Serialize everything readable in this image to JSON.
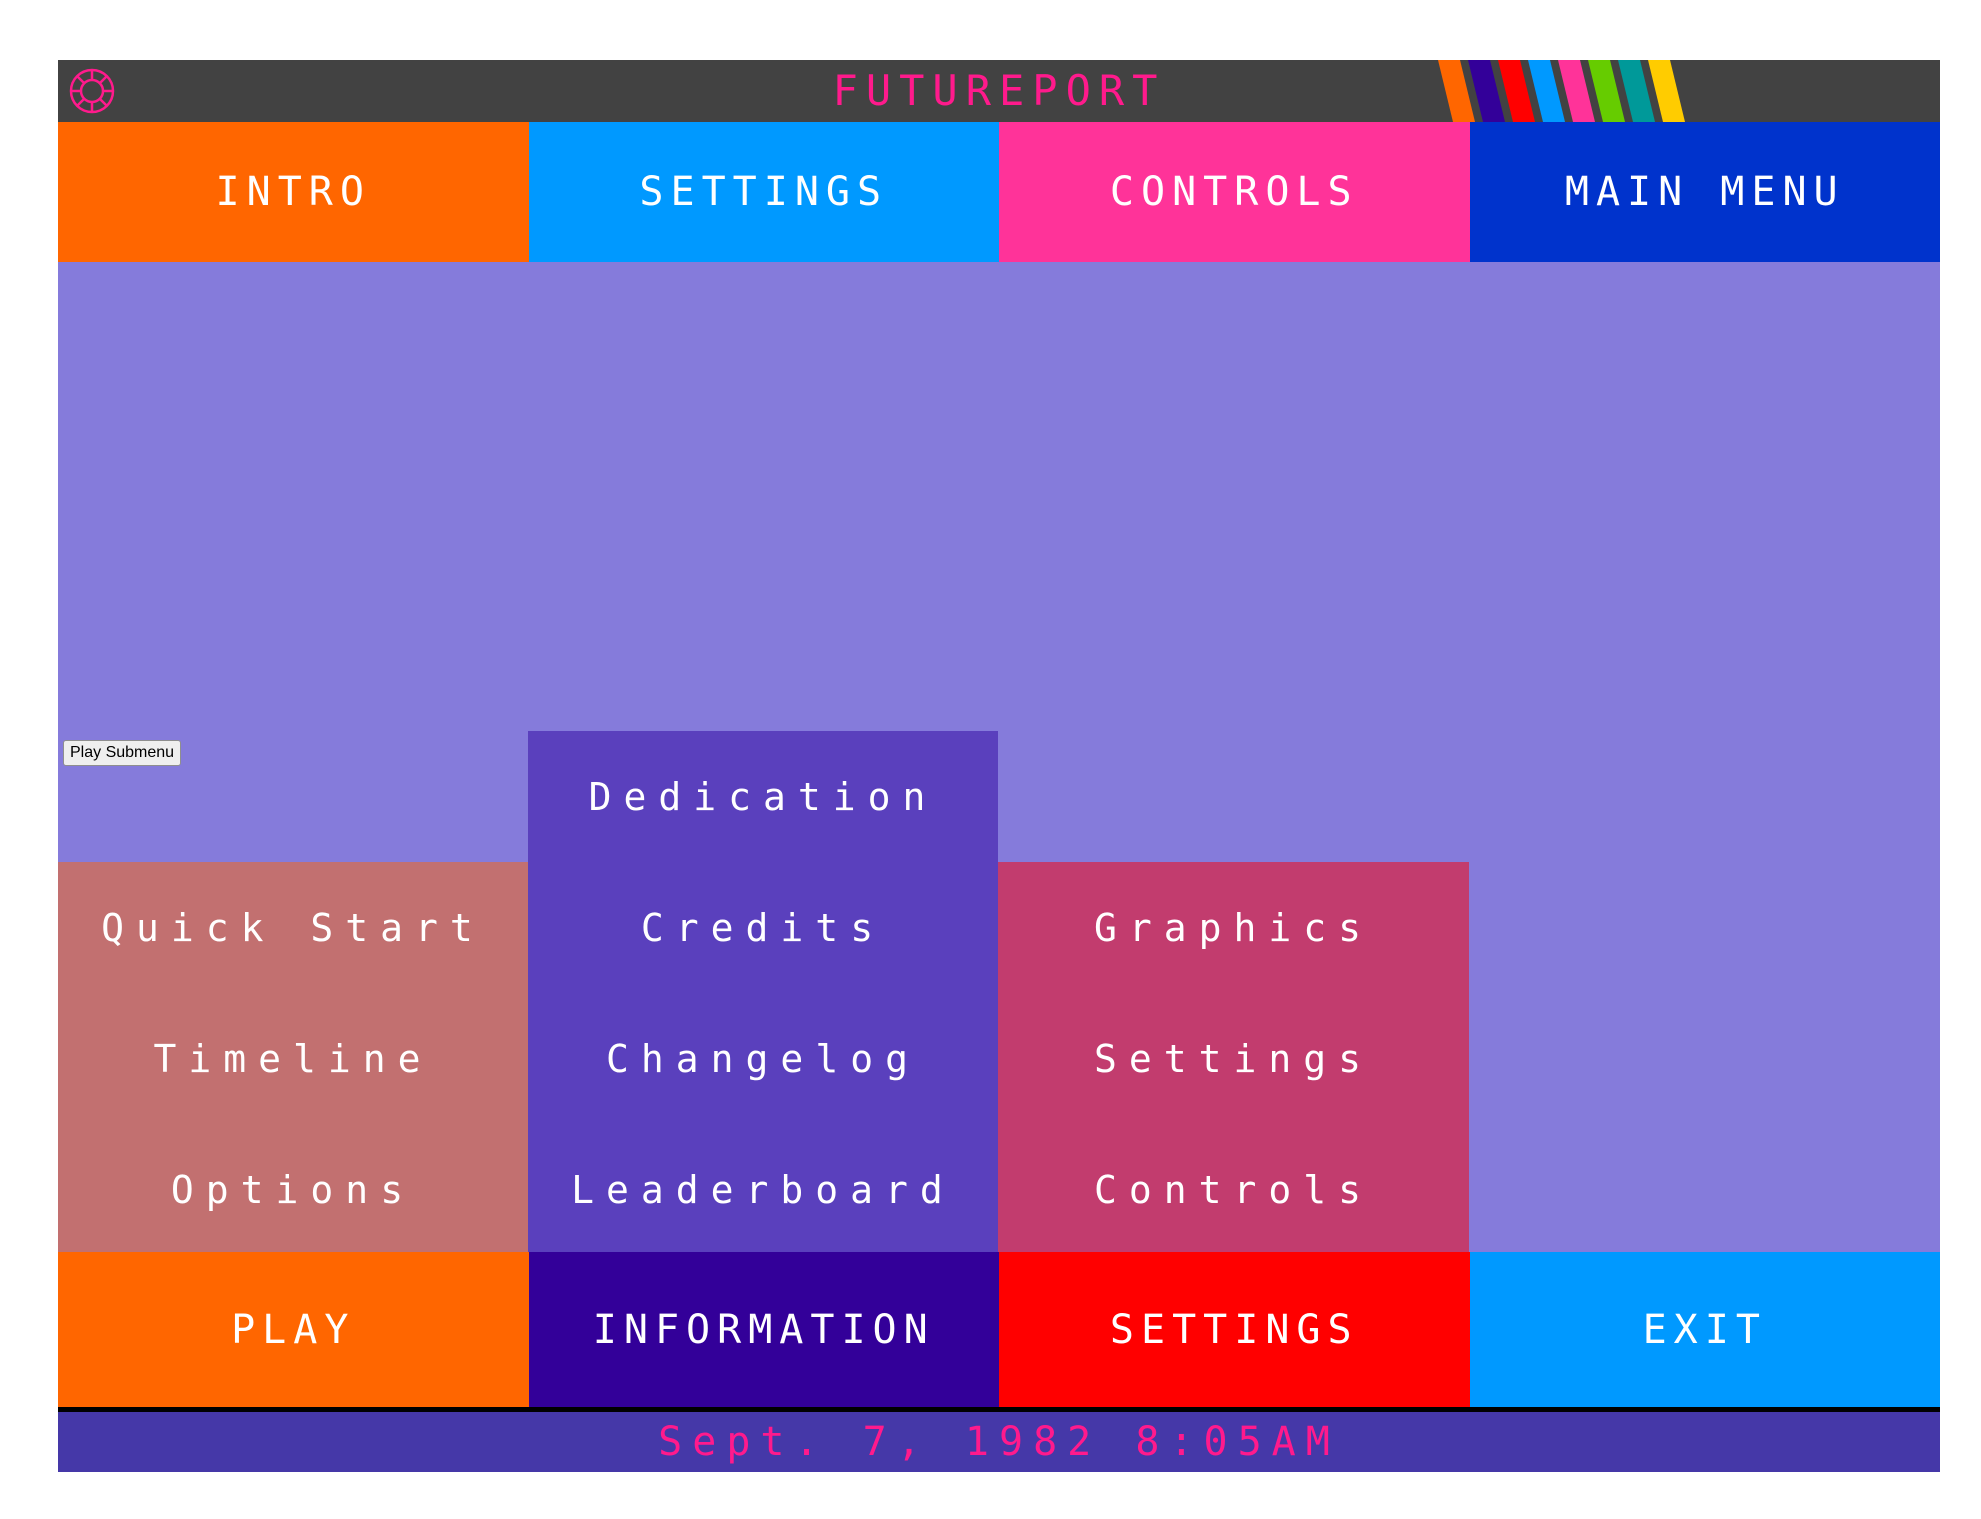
{
  "app": {
    "title": "FUTUREPORT",
    "logo_icon": "gear-ring-icon",
    "accent": "#ff1a8c",
    "stripe_colors": [
      "#ff6600",
      "#330099",
      "#ff0000",
      "#0099ff",
      "#ff3399",
      "#66cc00",
      "#009999",
      "#ffcc00"
    ]
  },
  "topnav": [
    {
      "label": "INTRO",
      "color": "#ff6600"
    },
    {
      "label": "SETTINGS",
      "color": "#0099ff"
    },
    {
      "label": "CONTROLS",
      "color": "#ff3399"
    },
    {
      "label": "MAIN MENU",
      "color": "#0033cc"
    }
  ],
  "main": {
    "background": "#857bdb",
    "play_submenu_button": "Play Submenu"
  },
  "submenus": {
    "play": {
      "color": "#c27070",
      "items": [
        "Quick Start",
        "Timeline",
        "Options"
      ]
    },
    "information": {
      "color": "#5a40bd",
      "items": [
        "Dedication",
        "Credits",
        "Changelog",
        "Leaderboard"
      ]
    },
    "settings": {
      "color": "#c23c6e",
      "items": [
        "Graphics",
        "Settings",
        "Controls"
      ]
    }
  },
  "bottomnav": [
    {
      "label": "PLAY",
      "color": "#ff6600"
    },
    {
      "label": "INFORMATION",
      "color": "#330099"
    },
    {
      "label": "SETTINGS",
      "color": "#ff0000"
    },
    {
      "label": "EXIT",
      "color": "#0099ff"
    }
  ],
  "status": {
    "datetime": "Sept. 7, 1982 8:05AM"
  }
}
